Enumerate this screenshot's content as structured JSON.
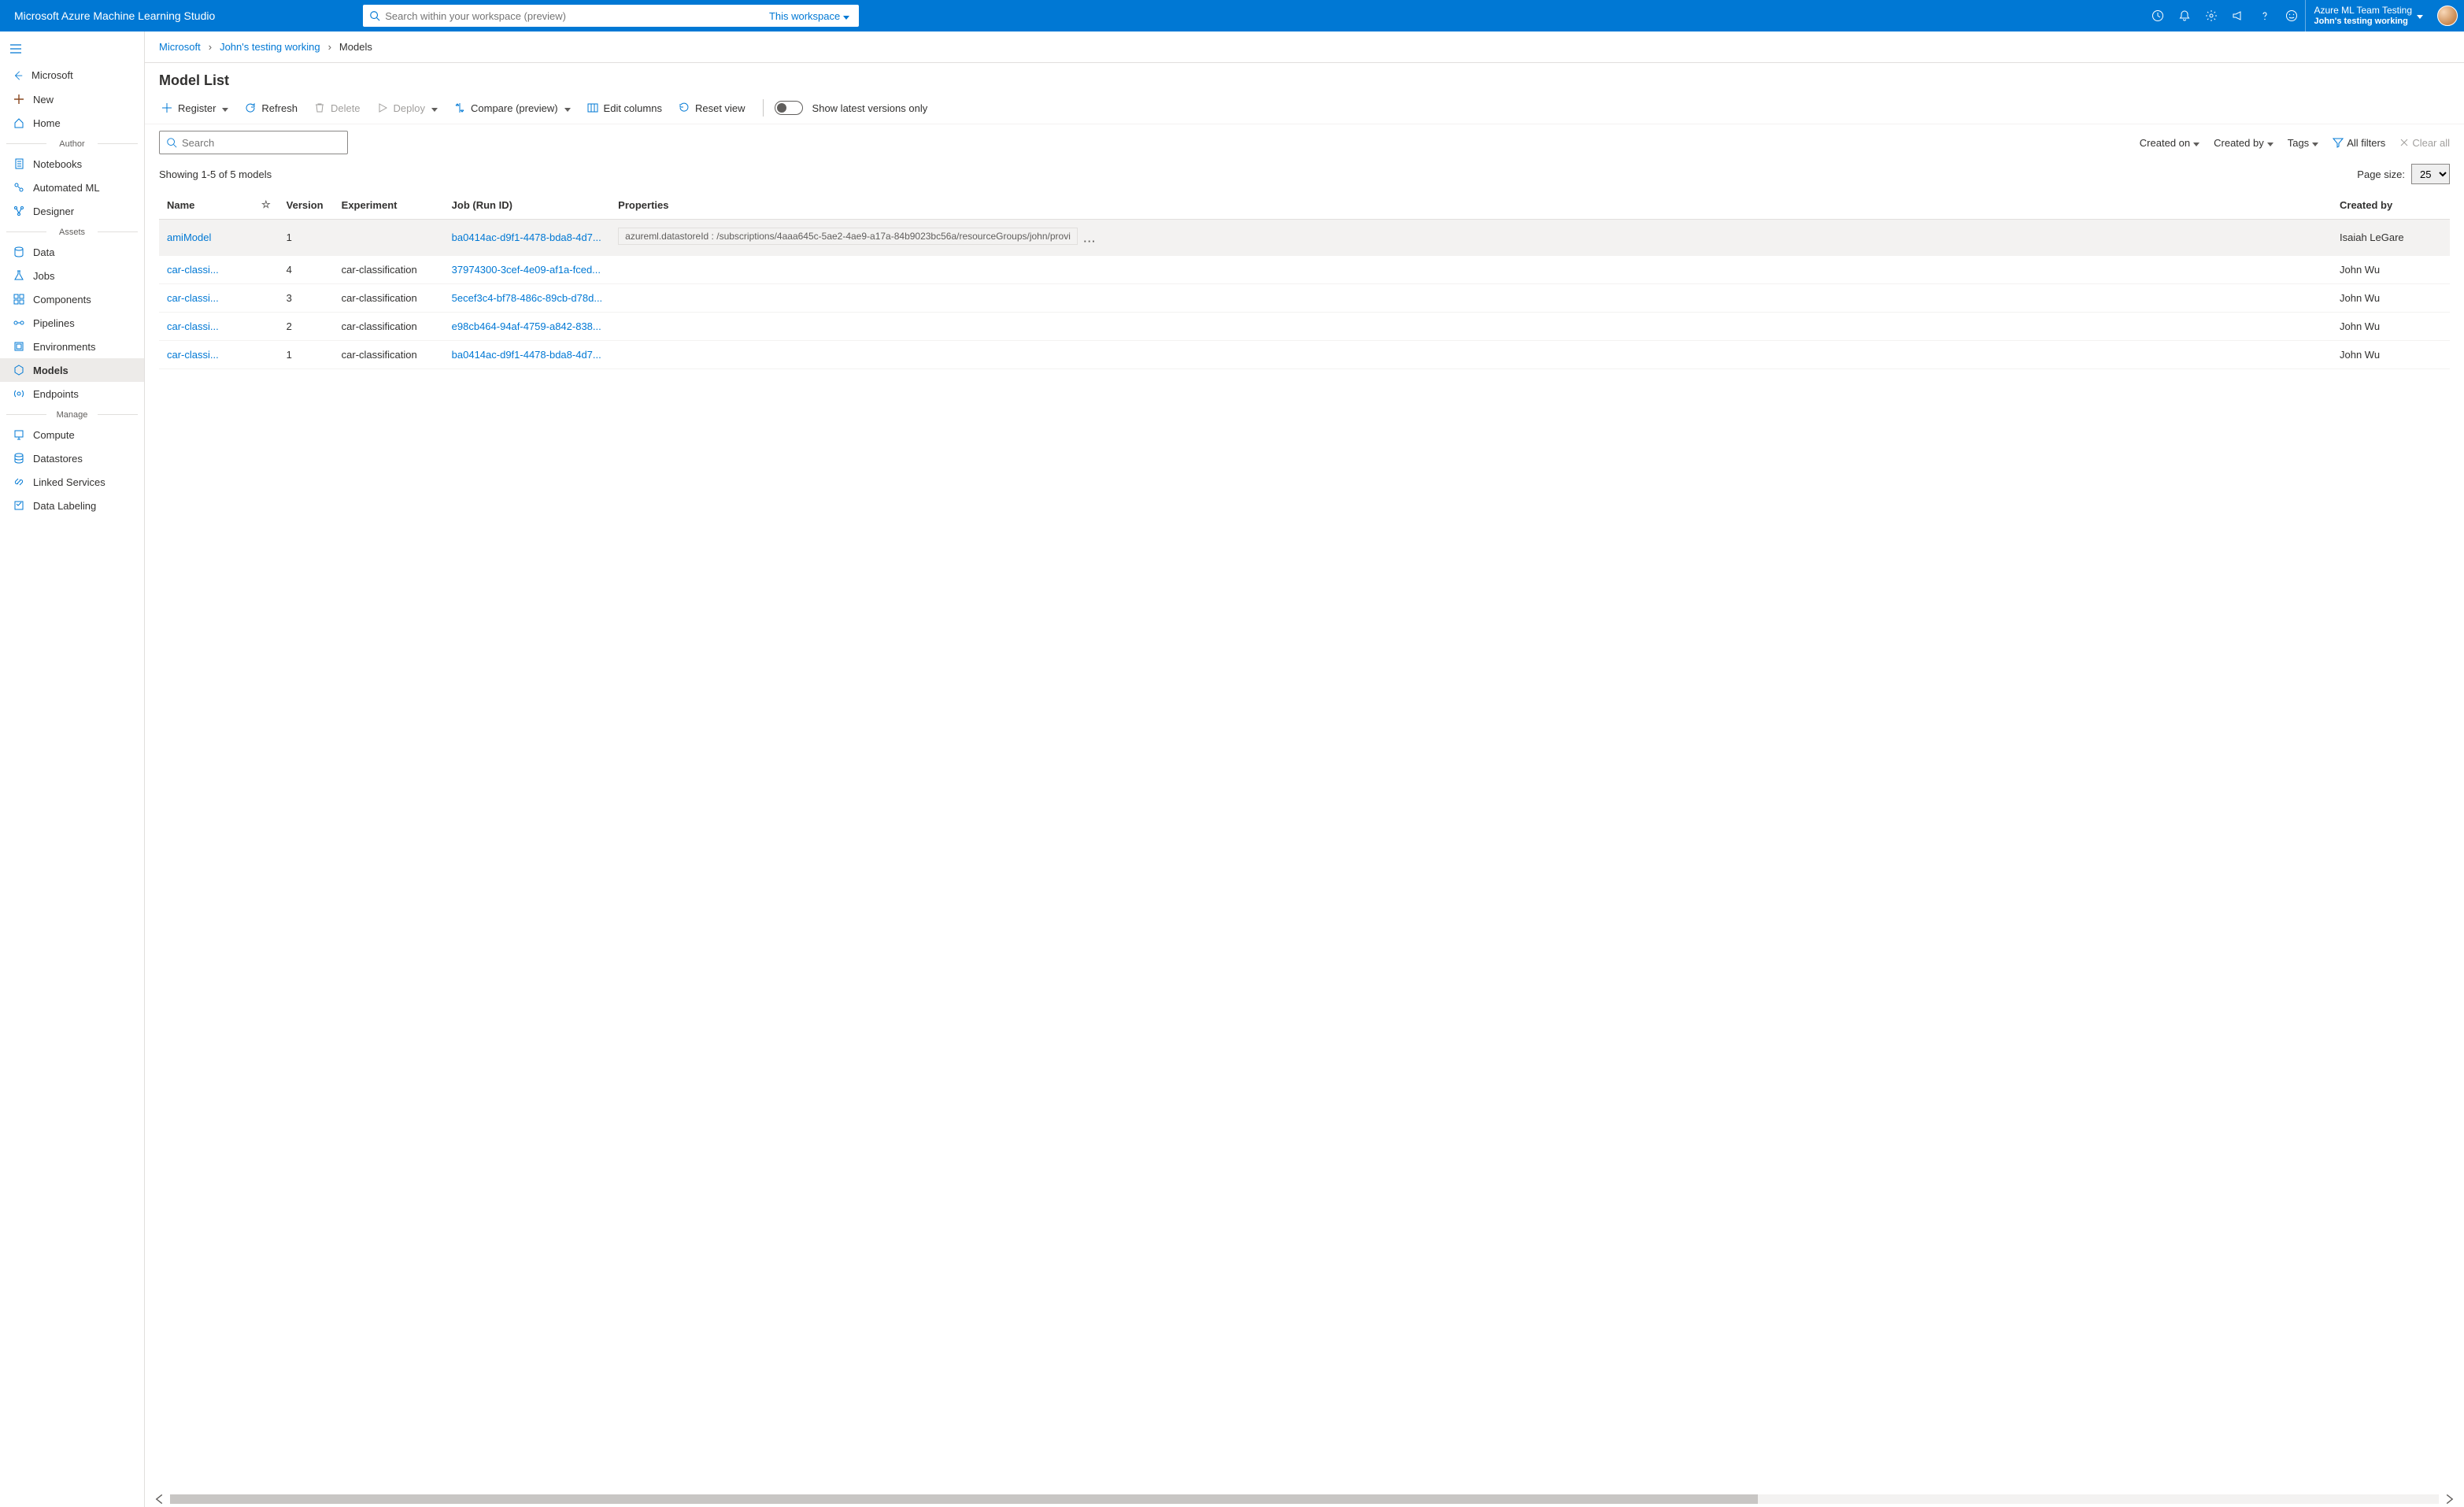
{
  "header": {
    "brand": "Microsoft Azure Machine Learning Studio",
    "search_placeholder": "Search within your workspace (preview)",
    "scope_label": "This workspace",
    "tenant_name": "Azure ML Team Testing",
    "workspace_name": "John's testing working"
  },
  "sidebar": {
    "back_label": "Microsoft",
    "top": [
      {
        "icon": "plus",
        "label": "New"
      },
      {
        "icon": "home",
        "label": "Home"
      }
    ],
    "groups": [
      {
        "title": "Author",
        "items": [
          {
            "icon": "notebook",
            "label": "Notebooks"
          },
          {
            "icon": "automl",
            "label": "Automated ML"
          },
          {
            "icon": "designer",
            "label": "Designer"
          }
        ]
      },
      {
        "title": "Assets",
        "items": [
          {
            "icon": "data",
            "label": "Data"
          },
          {
            "icon": "flask",
            "label": "Jobs"
          },
          {
            "icon": "components",
            "label": "Components"
          },
          {
            "icon": "pipeline",
            "label": "Pipelines"
          },
          {
            "icon": "env",
            "label": "Environments"
          },
          {
            "icon": "model",
            "label": "Models",
            "selected": true
          },
          {
            "icon": "endpoint",
            "label": "Endpoints"
          }
        ]
      },
      {
        "title": "Manage",
        "items": [
          {
            "icon": "compute",
            "label": "Compute"
          },
          {
            "icon": "datastore",
            "label": "Datastores"
          },
          {
            "icon": "link",
            "label": "Linked Services"
          },
          {
            "icon": "label",
            "label": "Data Labeling"
          }
        ]
      }
    ]
  },
  "breadcrumbs": [
    "Microsoft",
    "John's testing working",
    "Models"
  ],
  "page": {
    "title": "Model List",
    "toolbar": {
      "register": "Register",
      "refresh": "Refresh",
      "delete": "Delete",
      "deploy": "Deploy",
      "compare": "Compare (preview)",
      "edit_columns": "Edit columns",
      "reset_view": "Reset view",
      "show_latest": "Show latest versions only"
    },
    "search_placeholder": "Search",
    "filters": {
      "created_on": "Created on",
      "created_by": "Created by",
      "tags": "Tags",
      "all_filters": "All filters",
      "clear_all": "Clear all"
    },
    "count_text": "Showing 1-5 of 5 models",
    "page_size_label": "Page size:",
    "page_size_value": "25",
    "columns": [
      "Name",
      "",
      "Version",
      "Experiment",
      "Job (Run ID)",
      "Properties",
      "Created by"
    ],
    "rows": [
      {
        "name": "amiModel",
        "version": "1",
        "experiment": "",
        "job": "ba0414ac-d9f1-4478-bda8-4d7...",
        "properties": "azureml.datastoreId : /subscriptions/4aaa645c-5ae2-4ae9-a17a-84b9023bc56a/resourceGroups/john/provi",
        "created_by": "Isaiah LeGare",
        "hovered": true
      },
      {
        "name": "car-classi...",
        "version": "4",
        "experiment": "car-classification",
        "job": "37974300-3cef-4e09-af1a-fced...",
        "properties": "",
        "created_by": "John Wu"
      },
      {
        "name": "car-classi...",
        "version": "3",
        "experiment": "car-classification",
        "job": "5ecef3c4-bf78-486c-89cb-d78d...",
        "properties": "",
        "created_by": "John Wu"
      },
      {
        "name": "car-classi...",
        "version": "2",
        "experiment": "car-classification",
        "job": "e98cb464-94af-4759-a842-838...",
        "properties": "",
        "created_by": "John Wu"
      },
      {
        "name": "car-classi...",
        "version": "1",
        "experiment": "car-classification",
        "job": "ba0414ac-d9f1-4478-bda8-4d7...",
        "properties": "",
        "created_by": "John Wu"
      }
    ]
  }
}
